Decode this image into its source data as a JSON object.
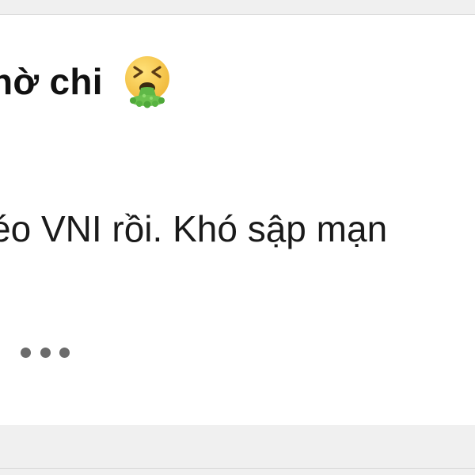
{
  "post": {
    "title": "hờ chi",
    "title_emoji": "vomiting-face-emoji",
    "body": "éo VNI rồi. Khó sập mạn",
    "more_icon": "ellipsis-icon"
  },
  "colors": {
    "background": "#f0f0f0",
    "card": "#ffffff",
    "text": "#111111",
    "dots": "#6b6b6b",
    "emoji_face": "#f2c84b",
    "emoji_vomit": "#5fb847"
  }
}
